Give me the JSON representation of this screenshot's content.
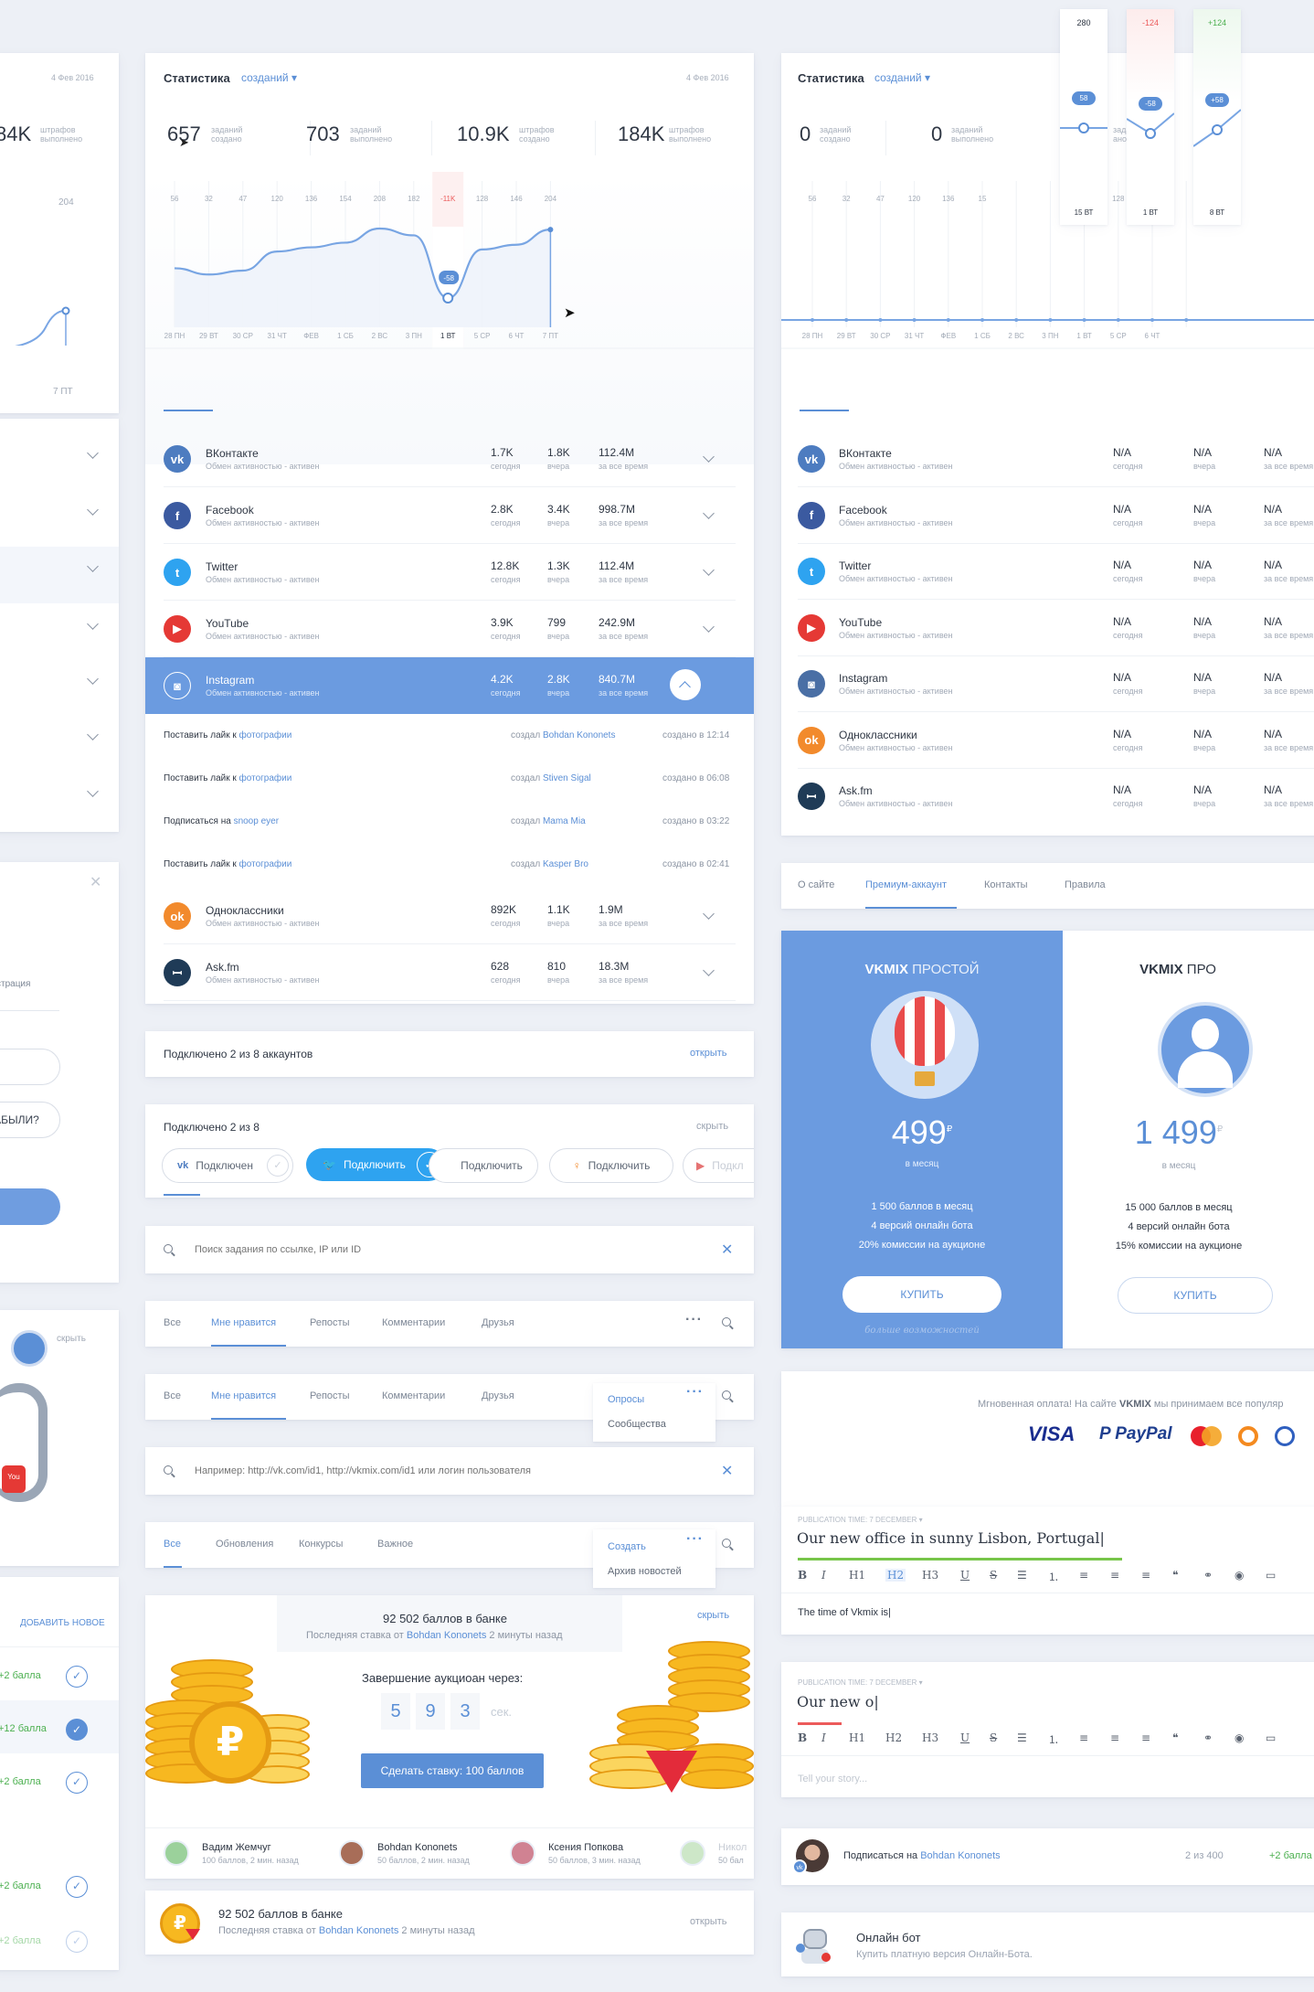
{
  "colors": {
    "accent": "#5b8fd6",
    "green": "#4cb050",
    "red": "#ec5b5b",
    "selected_row": "#6b9be0",
    "bg": "#edf0f6"
  },
  "stats_card": {
    "title": "Статистика",
    "dropdown": "созданий",
    "date": "4 Фев 2016",
    "kpis": [
      {
        "value": "657",
        "l1": "заданий",
        "l2": "создано"
      },
      {
        "value": "703",
        "l1": "заданий",
        "l2": "выполнено"
      },
      {
        "value": "10.9K",
        "l1": "штрафов",
        "l2": "создано"
      },
      {
        "value": "184K",
        "l1": "штрафов",
        "l2": "выполнено"
      }
    ],
    "top_ticks": [
      "56",
      "32",
      "47",
      "120",
      "136",
      "154",
      "208",
      "182",
      "-11K",
      "128",
      "146",
      "204"
    ],
    "tooltip": "-58",
    "x_labels": [
      "28 ПН",
      "29 ВТ",
      "30 СР",
      "31 ЧТ",
      "ФЕВ",
      "1 СБ",
      "2 ВС",
      "3 ПН",
      "1 ВТ",
      "5 СР",
      "6 ЧТ",
      "7 ПТ"
    ]
  },
  "chart_data": {
    "type": "line",
    "categories": [
      "28 ПН",
      "29 ВТ",
      "30 СР",
      "31 ЧТ",
      "ФЕВ",
      "1 СБ",
      "2 ВС",
      "3 ПН",
      "1 ВТ",
      "5 СР",
      "6 ЧТ",
      "7 ПТ"
    ],
    "values": [
      56,
      32,
      47,
      120,
      136,
      154,
      208,
      182,
      -58,
      128,
      146,
      204
    ],
    "highlight_index": 8
  },
  "left_card": {
    "date": "4 Фев 2016",
    "kpi": "84K",
    "l1": "штрафов",
    "l2": "выполнено",
    "tick": "204",
    "xlabel": "7 ПТ"
  },
  "networks": [
    {
      "icon": "vk-icon",
      "color": "#4d7cc0",
      "name": "ВКонтакте",
      "sub": "Обмен активностью - активен",
      "today": "1.7K",
      "yesterday": "1.8K",
      "total": "112.4M"
    },
    {
      "icon": "facebook-icon",
      "color": "#3b5aa0",
      "name": "Facebook",
      "sub": "Обмен активностью - активен",
      "today": "2.8K",
      "yesterday": "3.4K",
      "total": "998.7M"
    },
    {
      "icon": "twitter-icon",
      "color": "#2ea3f0",
      "name": "Twitter",
      "sub": "Обмен активностью - активен",
      "today": "12.8K",
      "yesterday": "1.3K",
      "total": "112.4M"
    },
    {
      "icon": "youtube-icon",
      "color": "#e53935",
      "name": "YouTube",
      "sub": "Обмен активностью - активен",
      "today": "3.9K",
      "yesterday": "799",
      "total": "242.9M"
    },
    {
      "icon": "instagram-icon",
      "color": "#ffffff",
      "name": "Instagram",
      "sub": "Обмен активностью - активен",
      "today": "4.2K",
      "yesterday": "2.8K",
      "total": "840.7M"
    }
  ],
  "networks_after": [
    {
      "icon": "odnoklassniki-icon",
      "color": "#f28a2c",
      "name": "Одноклассники",
      "sub": "Обмен активностью - активен",
      "today": "892K",
      "yesterday": "1.1K",
      "total": "1.9M"
    },
    {
      "icon": "askfm-icon",
      "color": "#1f3b57",
      "name": "Ask.fm",
      "sub": "Обмен активностью - активен",
      "today": "628",
      "yesterday": "810",
      "total": "18.3M"
    }
  ],
  "labels": {
    "today": "сегодня",
    "yesterday": "вчера",
    "total": "за все время",
    "na": "N/A"
  },
  "activity": [
    {
      "action": "Поставить лайк к",
      "link": "фотографии",
      "by": "создал",
      "author": "Bohdan Kononets",
      "when": "создано в 12:14"
    },
    {
      "action": "Поставить лайк к",
      "link": "фотографии",
      "by": "создал",
      "author": "Stiven Sigal",
      "when": "создано в 06:08"
    },
    {
      "action": "Подписаться на",
      "link": "snoop eyer",
      "by": "создал",
      "author": "Mama Mia",
      "when": "создано в 03:22"
    },
    {
      "action": "Поставить лайк к",
      "link": "фотографии",
      "by": "создал",
      "author": "Kasper Bro",
      "when": "создано в 02:41"
    }
  ],
  "connected_1": {
    "text": "Подключено 2 из 8 аккаунтов",
    "link": "открыть"
  },
  "connected_2": {
    "text": "Подключено 2 из 8",
    "link": "скрыть",
    "chips": [
      {
        "icon": "vk-icon",
        "label": "Подключен"
      },
      {
        "icon": "twitter-icon",
        "label": "Подключить"
      },
      {
        "icon": "facebook-icon",
        "label": "Подключить"
      },
      {
        "icon": "odnoklassniki-icon",
        "label": "Подключить"
      },
      {
        "icon": "youtube-icon",
        "label": "Подкл"
      }
    ]
  },
  "search1": {
    "placeholder": "Поиск задания по ссылке, IP или ID"
  },
  "tabs1": [
    "Все",
    "Мне нравится",
    "Репосты",
    "Комментарии",
    "Друзья"
  ],
  "tabs2": {
    "items": [
      "Все",
      "Мне нравится",
      "Репосты",
      "Комментарии",
      "Друзья"
    ],
    "menu": [
      "Опросы",
      "Сообщества"
    ]
  },
  "search2": {
    "placeholder": "Например: http://vk.com/id1, http://vkmix.com/id1 или логин пользователя"
  },
  "tabs3": {
    "items": [
      "Все",
      "Обновления",
      "Конкурсы",
      "Важное"
    ],
    "menu": [
      "Создать",
      "Архив новостей"
    ]
  },
  "auction": {
    "bank": "92 502 баллов в банке",
    "last_pre": "Последняя ставка от",
    "last_name": "Bohdan Kononets",
    "last_post": "2 минуты назад",
    "hide": "скрыть",
    "ends": "Завершение аукциоан через:",
    "digits": [
      "5",
      "9",
      "3"
    ],
    "sec": "сек.",
    "bid": "Сделать ставку: 100 баллов",
    "bidders": [
      {
        "name": "Вадим Жемчуг",
        "info": "100 баллов, 2 мин. назад"
      },
      {
        "name": "Bohdan Kononets",
        "info": "50 баллов, 2 мин. назад"
      },
      {
        "name": "Ксения Попкова",
        "info": "50 баллов, 3 мин. назад"
      },
      {
        "name": "Никол",
        "info": "50 бал"
      }
    ]
  },
  "bank_small": {
    "title": "92 502 баллов в банке",
    "pre": "Последняя ставка от",
    "name": "Bohdan Kononets",
    "post": "2 минуты назад",
    "link": "открыть"
  },
  "right_stats": {
    "title": "Статистика",
    "dropdown": "созданий",
    "kpis": [
      {
        "value": "0",
        "l1": "заданий",
        "l2": "создано"
      },
      {
        "value": "0",
        "l1": "заданий",
        "l2": "выполнено"
      },
      {
        "value": "",
        "l1": "заданий",
        "l2": "ано"
      }
    ],
    "ticks": [
      "56",
      "32",
      "47",
      "120",
      "136",
      "15",
      "128",
      "146"
    ],
    "x_labels": [
      "28 ПН",
      "29 ВТ",
      "30 СР",
      "31 ЧТ",
      "ФЕВ",
      "1 СБ",
      "2 ВС",
      "3 ПН",
      "1 ВТ",
      "5 СР",
      "6 ЧТ"
    ],
    "popups": [
      {
        "top": "280",
        "val": "58",
        "day": "15 ВТ"
      },
      {
        "top": "-124",
        "val": "-58",
        "day": "1 ВТ"
      },
      {
        "top": "+124",
        "val": "+58",
        "day": "8 ВТ"
      }
    ]
  },
  "right_networks": [
    "ВКонтакте",
    "Facebook",
    "Twitter",
    "YouTube",
    "Instagram",
    "Одноклассники",
    "Ask.fm"
  ],
  "right_net_sub": "Обмен активностью - активен",
  "about_tabs": [
    "О сайте",
    "Премиум-аккаунт",
    "Контакты",
    "Правила"
  ],
  "plan1": {
    "brand": "VKMIX",
    "kind": "ПРОСТОЙ",
    "price": "499",
    "cur": "₽",
    "per": "в месяц",
    "f1": "1 500 баллов в месяц",
    "f2": "4 версий онлайн бота",
    "f3": "20% комиссии на аукционе",
    "buy": "КУПИТЬ",
    "more": "больше возможностей"
  },
  "plan2": {
    "brand": "VKMIX",
    "kind": "ПРО",
    "price": "1 499",
    "cur": "₽",
    "per": "в месяц",
    "f1": "15 000 баллов в месяц",
    "f2": "4 версий онлайн бота",
    "f3": "15% комиссии на аукционе",
    "buy": "КУПИТЬ"
  },
  "payment": {
    "text_pre": "Мгновенная оплата! На сайте",
    "brand": "VKMIX",
    "text_post": "мы принимаем все популяр",
    "visa": "VISA",
    "paypal": "PayPal"
  },
  "editor1": {
    "meta": "PUBLICATION TIME: 7 DECEMBER",
    "title": "Our new office in sunny Lisbon, Portugal",
    "body": "The time of Vkmix is"
  },
  "editor2": {
    "meta": "PUBLICATION TIME: 7 DECEMBER",
    "title": "Our new o",
    "body_placeholder": "Tell your story..."
  },
  "toolbar": [
    "B",
    "I",
    "H1",
    "H2",
    "H3",
    "U",
    "S"
  ],
  "subscribe": {
    "pre": "Подписаться на",
    "name": "Bohdan Kononets",
    "count": "2 из 400",
    "points": "+2 балла"
  },
  "bot": {
    "title": "Онлайн бот",
    "sub": "Купить платную версия Онлайн-Бота."
  },
  "left_col": {
    "registration": "страция",
    "forgot": "АБЫЛИ?",
    "hide": "скрыть",
    "add_new": "ДОБАВИТЬ НОВОЕ",
    "points": [
      "+2 балла",
      "+12 балла",
      "+2 балла",
      "+2 балла",
      "+2 балла"
    ]
  }
}
